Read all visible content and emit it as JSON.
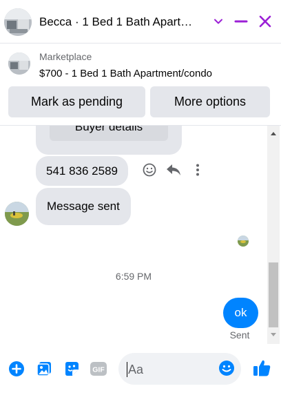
{
  "header": {
    "title": "Becca · 1 Bed 1 Bath Apart…",
    "accent_color": "#9b1fd6",
    "icons": [
      "chevron-down-icon",
      "minimize-icon",
      "close-icon"
    ]
  },
  "banner": {
    "label": "Marketplace",
    "listing": "$700 - 1 Bed 1 Bath Apartment/condo",
    "buttons": {
      "pending": "Mark as pending",
      "more": "More options"
    }
  },
  "chat": {
    "buyer_details_label": "Buyer details",
    "phone_message": "541 836 2589",
    "received_message": "Message sent",
    "timestamp": "6:59 PM",
    "sent_message": "ok",
    "sent_status": "Sent",
    "bubble_color": "#0084ff"
  },
  "composer": {
    "placeholder": "Aa",
    "gif_label": "GIF",
    "icon_color": "#0084ff",
    "icons": [
      "add-icon",
      "photo-icon",
      "sticker-icon",
      "gif-icon",
      "emoji-icon",
      "like-icon"
    ]
  }
}
